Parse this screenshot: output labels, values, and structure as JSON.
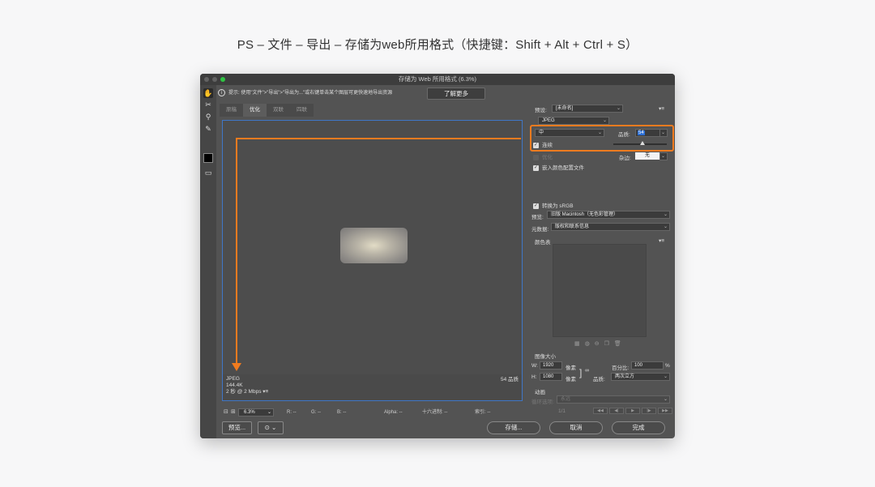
{
  "caption": "PS – 文件 – 导出 – 存储为web所用格式（快捷键：Shift + Alt + Ctrl + S）",
  "window": {
    "title": "存储为 Web 所用格式 (6.3%)",
    "hint": "提示: 使用\"文件\">\"导出\">\"导出为...\"或右键单击某个图层可更快速地导出资源",
    "learn_more": "了解更多"
  },
  "tabs": [
    "原稿",
    "优化",
    "双联",
    "四联"
  ],
  "active_tab": "优化",
  "canvas": {
    "format": "JPEG",
    "size": "144.4K",
    "speed": "2 秒 @ 2 Mbps",
    "speed_menu": "▾≡",
    "quality": "54 品质"
  },
  "status": {
    "zoom": "6.3%",
    "r": "R: --",
    "g": "G: --",
    "b": "B: --",
    "alpha": "Alpha: --",
    "hex": "十六进制: --",
    "index": "索引: --"
  },
  "bottom": {
    "preview": "预览...",
    "save": "存储...",
    "cancel": "取消",
    "done": "完成"
  },
  "right_panel": {
    "preset_label": "预设:",
    "preset_value": "[未命名]",
    "format": "JPEG",
    "compression": "中",
    "quality_label": "品质:",
    "quality_value": "54",
    "quality_fraction": 0.54,
    "progressive": "连续",
    "optimized": "优化",
    "blur_label": "杂边:",
    "blur_value": "无",
    "embed_profile": "嵌入颜色配置文件",
    "convert_srgb": "转换为 sRGB",
    "preview_label": "预览:",
    "preview_value": "旧版 Macintosh（无色彩管理）",
    "metadata_label": "元数据:",
    "metadata_value": "版权和联系信息",
    "color_table": "颜色表",
    "image_size": "图像大小",
    "w_label": "W:",
    "w_value": "1920",
    "h_label": "H:",
    "h_value": "1080",
    "px": "像素",
    "percent_label": "百分比:",
    "percent_value": "100",
    "percent_unit": "%",
    "resample_label": "品质:",
    "resample_value": "两次立方",
    "animation": "动画",
    "loop_label": "循环选项:",
    "loop_value": "永远",
    "frame": "1/1"
  }
}
